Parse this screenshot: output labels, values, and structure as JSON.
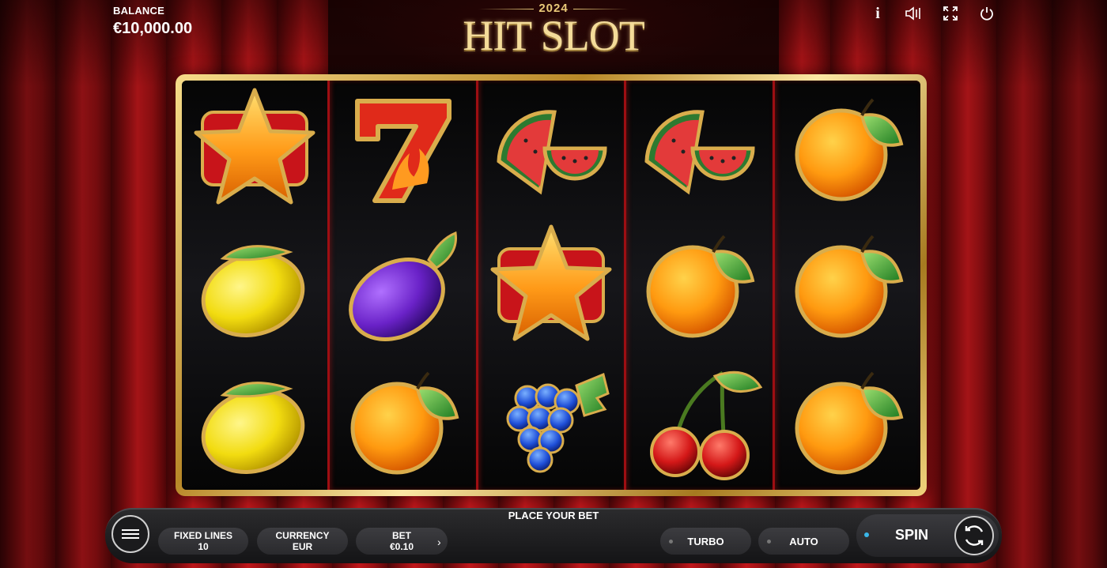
{
  "balance": {
    "label": "BALANCE",
    "value": "€10,000.00"
  },
  "logo": {
    "year": "2024",
    "title": "HIT SLOT"
  },
  "top_icons": [
    "info-icon",
    "sound-icon",
    "fullscreen-icon",
    "power-icon"
  ],
  "top_icon_glyphs": {
    "info": "i"
  },
  "reels": [
    [
      "star",
      "lemon",
      "lemon"
    ],
    [
      "seven",
      "plum",
      "orange"
    ],
    [
      "watermelon",
      "star",
      "grapes"
    ],
    [
      "watermelon",
      "orange",
      "cherries"
    ],
    [
      "orange",
      "orange",
      "orange"
    ]
  ],
  "bottom": {
    "prompt": "PLACE YOUR BET",
    "fixed_lines": {
      "label": "FIXED LINES",
      "value": "10"
    },
    "currency": {
      "label": "CURRENCY",
      "value": "EUR"
    },
    "bet": {
      "label": "BET",
      "value": "€0.10"
    },
    "turbo": "TURBO",
    "auto": "AUTO",
    "spin": "SPIN"
  },
  "colors": {
    "curtain": "#b8151a",
    "frame_gold": "#e6c26a",
    "spin_dot": "#3ab6e8"
  }
}
